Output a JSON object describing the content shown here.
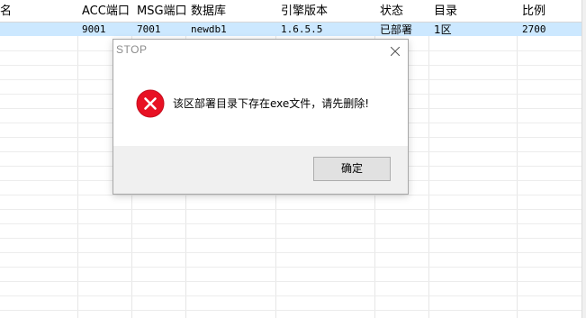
{
  "table": {
    "headers": [
      "名",
      "ACC端口",
      "MSG端口",
      "数据库",
      "引擎版本",
      "状态",
      "目录",
      "比例"
    ],
    "selected_row": [
      "9001",
      "7001",
      "newdb1",
      "1.6.5.5",
      "已部署",
      "1区",
      "2700"
    ]
  },
  "dialog": {
    "title": "STOP",
    "message": "该区部署目录下存在exe文件，请先删除!",
    "ok_label": "确定",
    "icon": "error-icon",
    "icon_color": "#e81123"
  },
  "colors": {
    "selection": "#cce8ff",
    "dialog_footer": "#f0f0f0",
    "button_face": "#e1e1e1"
  }
}
